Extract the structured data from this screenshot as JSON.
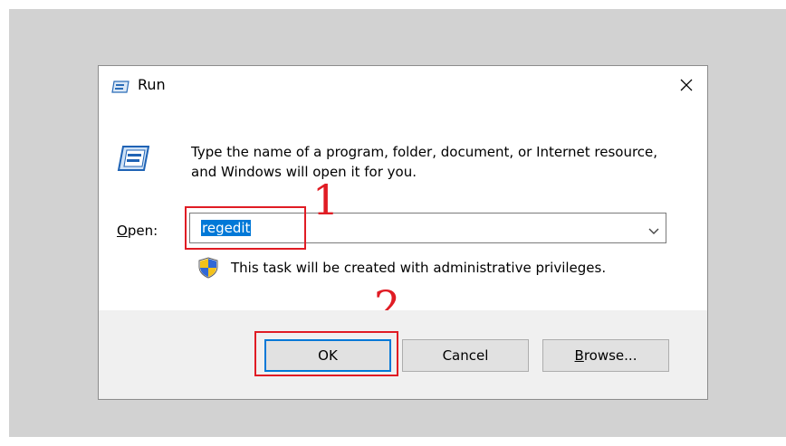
{
  "window": {
    "title": "Run",
    "title_icon": "run-icon",
    "close_icon": "close-icon"
  },
  "content": {
    "icon": "run-icon",
    "description": "Type the name of a program, folder, document, or Internet resource, and Windows will open it for you.",
    "open_label_mnemonic": "O",
    "open_label_rest": "pen:",
    "open_value": "regedit",
    "dropdown_icon": "chevron-down-icon",
    "admin_icon": "uac-shield-icon",
    "admin_text": "This task will be created with administrative privileges."
  },
  "annotations": {
    "step1": "1",
    "step2": "2",
    "color": "#e01c24"
  },
  "buttons": {
    "ok": "OK",
    "cancel": "Cancel",
    "browse_mnemonic": "B",
    "browse_rest": "rowse..."
  },
  "colors": {
    "selection": "#0078d7",
    "footer": "#f0f0f0",
    "backdrop": "#d2d2d2"
  }
}
